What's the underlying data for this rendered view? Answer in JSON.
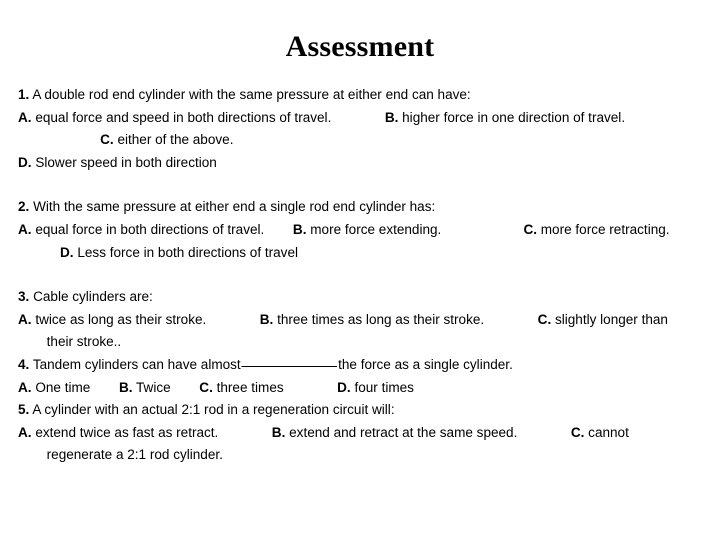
{
  "slide": {
    "title": "Assessment",
    "background_color": "#ffffff",
    "text_color": "#000000"
  },
  "questions": [
    {
      "number": "1.",
      "prompt": "A double rod end cylinder with the same pressure at either end can have:",
      "options": [
        {
          "label": "A.",
          "text": "equal force and speed in both directions of travel."
        },
        {
          "label": "B.",
          "text": "higher force in one direction of travel."
        },
        {
          "label": "C.",
          "text": "either of the above."
        },
        {
          "label": "D.",
          "text": "Slower speed in both direction"
        }
      ]
    },
    {
      "number": "2.",
      "prompt": "With the same pressure at either end a single rod end cylinder has:",
      "options": [
        {
          "label": "A.",
          "text": "equal force in both directions of travel."
        },
        {
          "label": "B.",
          "text": "more force extending."
        },
        {
          "label": "C.",
          "text": "more force retracting."
        },
        {
          "label": "D.",
          "text": "Less force in both directions of travel"
        }
      ]
    },
    {
      "number": "3.",
      "prompt": "Cable cylinders are:",
      "options": [
        {
          "label": "A.",
          "text": "twice as long as their stroke."
        },
        {
          "label": "B.",
          "text": "three times as long as their stroke."
        },
        {
          "label": "C.",
          "text": "slightly longer than their stroke.."
        }
      ]
    },
    {
      "number": "4.",
      "prompt_before_blank": "Tandem cylinders can have almost",
      "prompt_after_blank": "the force as a single cylinder.",
      "options": [
        {
          "label": "A.",
          "text": "One time"
        },
        {
          "label": "B.",
          "text": "Twice"
        },
        {
          "label": "C.",
          "text": "three times"
        },
        {
          "label": "D.",
          "text": "four times"
        }
      ]
    },
    {
      "number": "5.",
      "prompt": "A cylinder with an actual 2:1 rod in a regeneration circuit will:",
      "options": [
        {
          "label": "A.",
          "text": "extend twice as fast as retract."
        },
        {
          "label": "B.",
          "text": "extend and retract at the same speed."
        },
        {
          "label": "C.",
          "text": "cannot regenerate a 2:1 rod cylinder."
        }
      ]
    }
  ]
}
